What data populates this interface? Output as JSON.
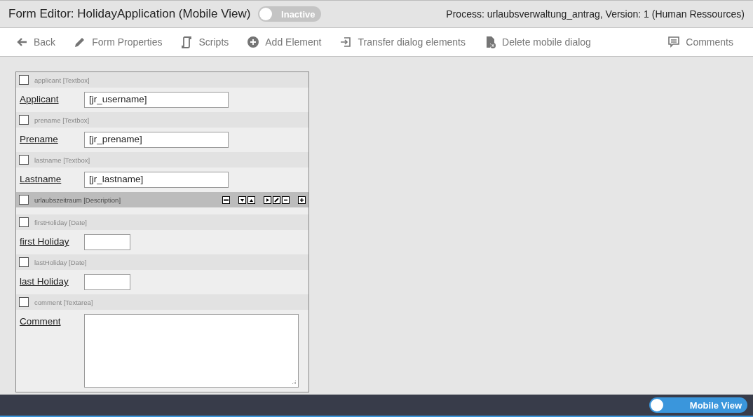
{
  "header": {
    "title": "Form Editor: HolidayApplication (Mobile View)",
    "status_toggle": {
      "label": "Inactive",
      "on": false
    },
    "process_info": "Process: urlaubsverwaltung_antrag, Version: 1 (Human Ressources)"
  },
  "toolbar": [
    {
      "label": "Back",
      "kind": "back"
    },
    {
      "label": "Form Properties",
      "kind": "pencil"
    },
    {
      "label": "Scripts",
      "kind": "script"
    },
    {
      "label": "Add Element",
      "kind": "plus"
    },
    {
      "label": "Transfer dialog elements",
      "kind": "transfer"
    },
    {
      "label": "Delete mobile dialog",
      "kind": "delete"
    }
  ],
  "comments_button": {
    "label": "Comments"
  },
  "form_elements": [
    {
      "name": "applicant [Textbox]",
      "checked": false,
      "selected": false,
      "kind": "textbox",
      "label": "Applicant",
      "value": "[jr_username]"
    },
    {
      "name": "prename [Textbox]",
      "checked": false,
      "selected": false,
      "kind": "textbox",
      "label": "Prename",
      "value": "[jr_prename]"
    },
    {
      "name": "lastname [Textbox]",
      "checked": false,
      "selected": false,
      "kind": "textbox",
      "label": "Lastname",
      "value": "[jr_lastname]"
    },
    {
      "name": "urlaubszeitraum [Description]",
      "checked": false,
      "selected": true,
      "kind": "description"
    },
    {
      "name": "firstHoliday [Date]",
      "checked": false,
      "selected": false,
      "kind": "date",
      "label": "first Holiday"
    },
    {
      "name": "lastHoliday [Date]",
      "checked": false,
      "selected": false,
      "kind": "date",
      "label": "last Holiday"
    },
    {
      "name": "comment [Textarea]",
      "checked": false,
      "selected": false,
      "kind": "textarea",
      "label": "Comment"
    }
  ],
  "footer": {
    "view_toggle": {
      "label": "Mobile View",
      "on": true
    }
  }
}
